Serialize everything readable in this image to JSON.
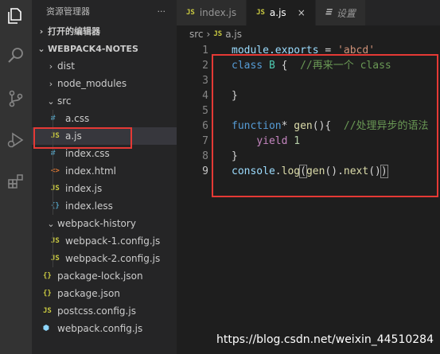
{
  "sidebar": {
    "title": "资源管理器",
    "more": "···",
    "open_editors": "打开的编辑器",
    "project": "WEBPACK4-NOTES",
    "items": [
      {
        "label": "dist",
        "type": "folder"
      },
      {
        "label": "node_modules",
        "type": "folder"
      },
      {
        "label": "src",
        "type": "folder-open"
      },
      {
        "label": "a.css",
        "icon": "#"
      },
      {
        "label": "a.js",
        "icon": "JS"
      },
      {
        "label": "index.css",
        "icon": "#"
      },
      {
        "label": "index.html",
        "icon": "<>"
      },
      {
        "label": "index.js",
        "icon": "JS"
      },
      {
        "label": "index.less",
        "icon": "{}"
      },
      {
        "label": "webpack-history",
        "type": "folder-open"
      },
      {
        "label": "webpack-1.config.js",
        "icon": "JS"
      },
      {
        "label": "webpack-2.config.js",
        "icon": "JS"
      },
      {
        "label": "package-lock.json",
        "icon": "{}"
      },
      {
        "label": "package.json",
        "icon": "{}"
      },
      {
        "label": "postcss.config.js",
        "icon": "JS"
      },
      {
        "label": "webpack.config.js",
        "icon": "webpack-icon"
      }
    ]
  },
  "tabs": [
    {
      "label": "index.js",
      "icon": "JS"
    },
    {
      "label": "a.js",
      "icon": "JS",
      "active": true,
      "close": "×"
    },
    {
      "label": "设置",
      "icon": "settings-icon"
    }
  ],
  "breadcrumb": {
    "folder": "src",
    "file_icon": "JS",
    "file": "a.js"
  },
  "editor": {
    "line_numbers": [
      "1",
      "2",
      "3",
      "4",
      "5",
      "6",
      "7",
      "8",
      "9"
    ],
    "current_line": "9",
    "lines": {
      "l1": [
        "module.exports",
        " = ",
        "'abcd'"
      ],
      "l2": [
        "class",
        " ",
        "B",
        " {  ",
        "//再来一个 class"
      ],
      "l4": [
        "}"
      ],
      "l6": [
        "function",
        "* ",
        "gen",
        "(){  ",
        "//处理异步的语法"
      ],
      "l7": [
        "    ",
        "yield",
        " ",
        "1"
      ],
      "l8": [
        "}"
      ],
      "l9": [
        "console",
        ".",
        "log",
        "(",
        "gen",
        "().",
        "next",
        "()",
        ")"
      ]
    }
  },
  "watermark": "https://blog.csdn.net/weixin_44510284",
  "colors": {
    "annotation": "#e53935",
    "activity_bar": "#333333",
    "sidebar": "#252526",
    "editor": "#1e1e1e"
  }
}
